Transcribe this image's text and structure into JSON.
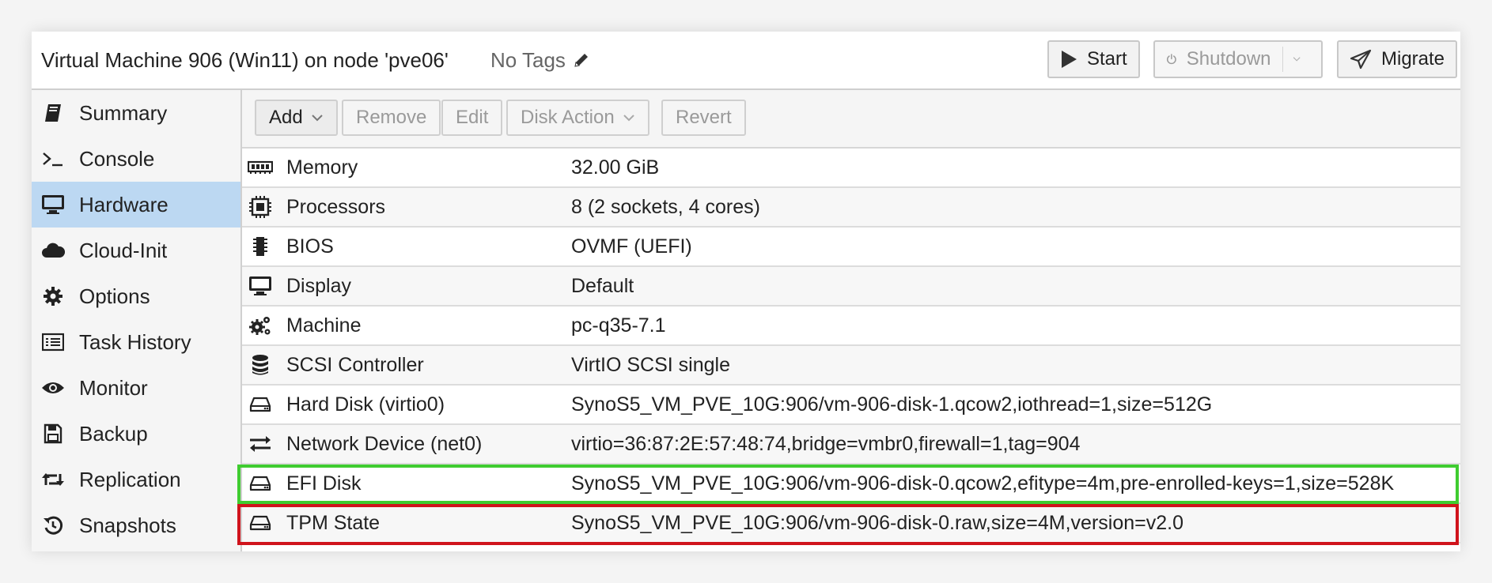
{
  "header": {
    "title": "Virtual Machine 906 (Win11) on node 'pve06'",
    "tags": "No Tags",
    "start_label": "Start",
    "shutdown_label": "Shutdown",
    "migrate_label": "Migrate"
  },
  "sidebar": {
    "items": [
      {
        "label": "Summary",
        "icon": "book-icon"
      },
      {
        "label": "Console",
        "icon": "terminal-icon"
      },
      {
        "label": "Hardware",
        "icon": "monitor-icon",
        "active": true
      },
      {
        "label": "Cloud-Init",
        "icon": "cloud-icon"
      },
      {
        "label": "Options",
        "icon": "gear-icon"
      },
      {
        "label": "Task History",
        "icon": "list-icon"
      },
      {
        "label": "Monitor",
        "icon": "eye-icon"
      },
      {
        "label": "Backup",
        "icon": "floppy-icon"
      },
      {
        "label": "Replication",
        "icon": "retweet-icon"
      },
      {
        "label": "Snapshots",
        "icon": "history-icon"
      }
    ]
  },
  "toolbar": {
    "add_label": "Add",
    "remove_label": "Remove",
    "edit_label": "Edit",
    "disk_action_label": "Disk Action",
    "revert_label": "Revert"
  },
  "hardware": {
    "rows": [
      {
        "name": "Memory",
        "value": "32.00 GiB",
        "icon": "memory-icon"
      },
      {
        "name": "Processors",
        "value": "8 (2 sockets, 4 cores)",
        "icon": "cpu-icon"
      },
      {
        "name": "BIOS",
        "value": "OVMF (UEFI)",
        "icon": "chip-icon"
      },
      {
        "name": "Display",
        "value": "Default",
        "icon": "display-icon"
      },
      {
        "name": "Machine",
        "value": "pc-q35-7.1",
        "icon": "cogs-icon"
      },
      {
        "name": "SCSI Controller",
        "value": "VirtIO SCSI single",
        "icon": "database-icon"
      },
      {
        "name": "Hard Disk (virtio0)",
        "value": "SynoS5_VM_PVE_10G:906/vm-906-disk-1.qcow2,iothread=1,size=512G",
        "icon": "hdd-icon"
      },
      {
        "name": "Network Device (net0)",
        "value": "virtio=36:87:2E:57:48:74,bridge=vmbr0,firewall=1,tag=904",
        "icon": "exchange-icon"
      },
      {
        "name": "EFI Disk",
        "value": "SynoS5_VM_PVE_10G:906/vm-906-disk-0.qcow2,efitype=4m,pre-enrolled-keys=1,size=528K",
        "icon": "hdd-icon",
        "highlight": "#3fcc30"
      },
      {
        "name": "TPM State",
        "value": "SynoS5_VM_PVE_10G:906/vm-906-disk-0.raw,size=4M,version=v2.0",
        "icon": "hdd-icon",
        "highlight": "#d0141c"
      }
    ]
  }
}
